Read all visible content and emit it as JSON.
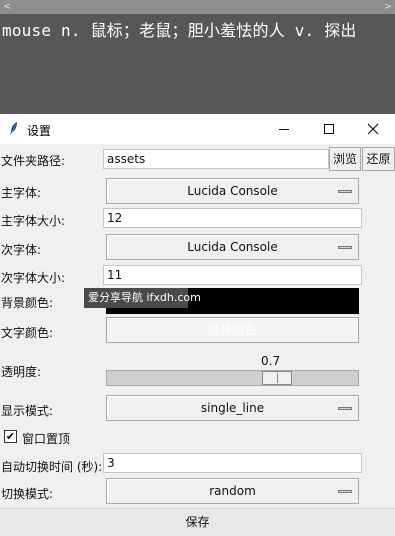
{
  "word_strip": {
    "scroll_left": "<",
    "scroll_right": ">",
    "text": "mouse  n. 鼠标；老鼠；胆小羞怯的人 v. 探出"
  },
  "window": {
    "title": "设置",
    "minimize": "—",
    "maximize": "☐",
    "close": "✕"
  },
  "form": {
    "folder_label": "文件夹路径:",
    "folder_value": "assets",
    "browse": "浏览",
    "restore": "还原",
    "primary_font_label": "主字体:",
    "primary_font_value": "Lucida Console",
    "primary_size_label": "主字体大小:",
    "primary_size_value": "12",
    "secondary_font_label": "次字体:",
    "secondary_font_value": "Lucida Console",
    "secondary_size_label": "次字体大小:",
    "secondary_size_value": "11",
    "bg_color_label": "背景颜色:",
    "bg_color": "#000000",
    "text_color_label": "文字颜色:",
    "text_color_button": "选择颜色",
    "opacity_label": "透明度:",
    "opacity_value": "0.7",
    "opacity_level": 0.7,
    "display_mode_label": "显示模式:",
    "display_mode_value": "single_line",
    "on_top_label": "窗口置顶",
    "on_top_checked": "✔",
    "interval_label": "自动切换时间 (秒):",
    "interval_value": "3",
    "switch_mode_label": "切换模式:",
    "switch_mode_value": "random",
    "save": "保存"
  },
  "watermark": "爱分享导航 ifxdh.com",
  "icons": {
    "app": "feather-icon",
    "checkbox": "check-icon"
  }
}
